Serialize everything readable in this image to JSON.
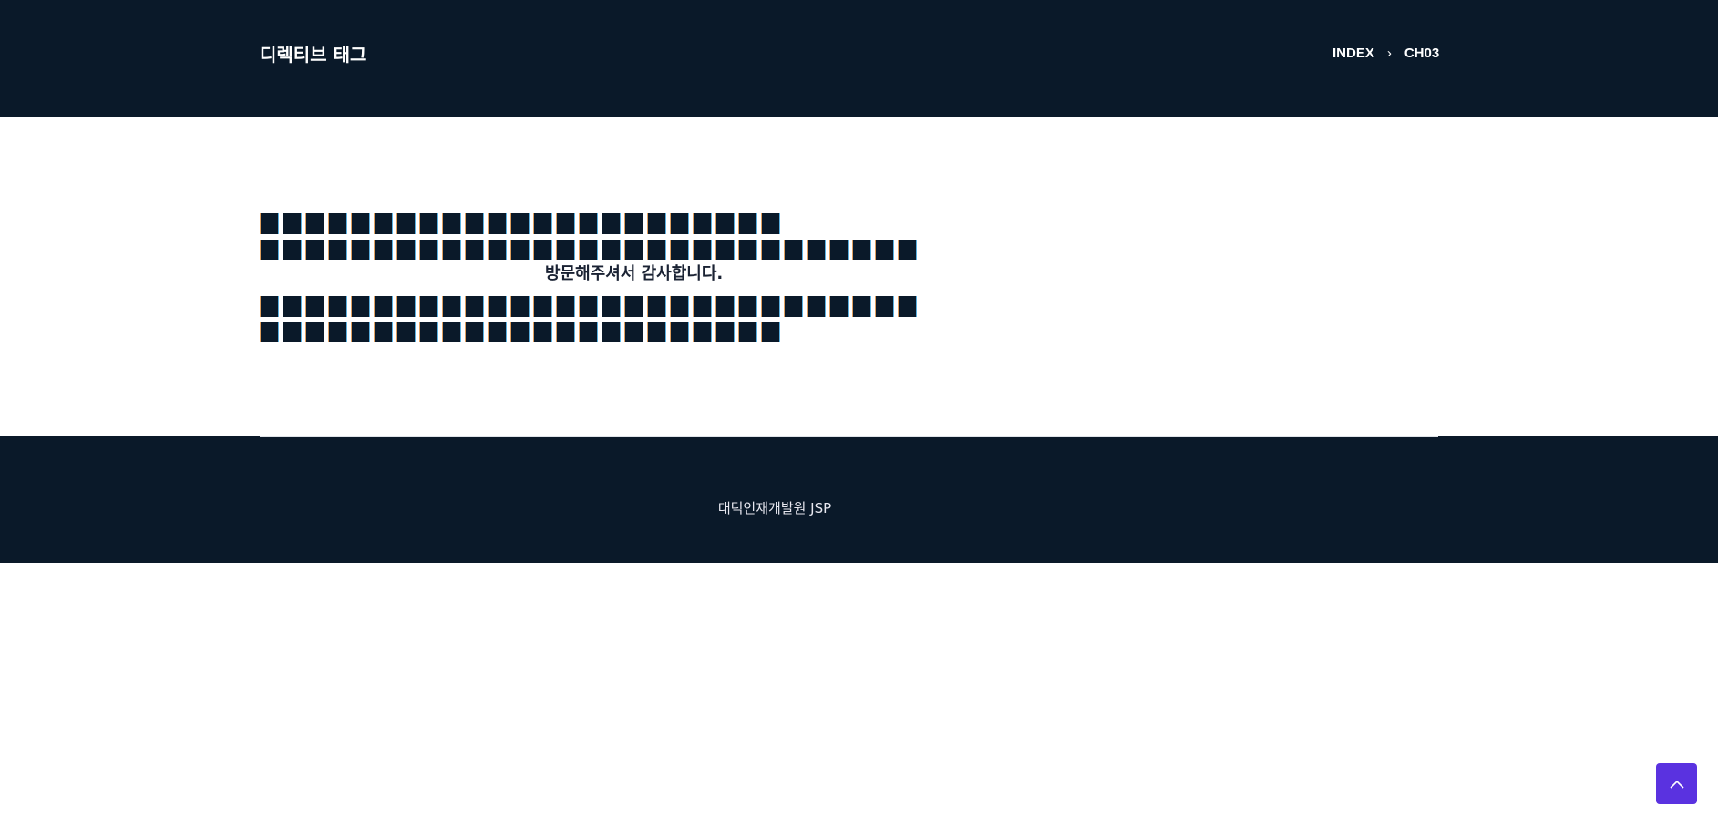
{
  "header": {
    "title": "디렉티브 태그",
    "breadcrumb": [
      {
        "label": "INDEX"
      },
      {
        "label": "CH03"
      }
    ]
  },
  "main": {
    "tofu_lines": [
      "■■■■■■■■■■■■■■■■■■■■■■■",
      "■■■■■■■■■■■■■■■■■■■■■■■■■■■■■",
      "■■■■■■■■■■■■■■■■■■■■■■■■■■■■■",
      "■■■■■■■■■■■■■■■■■■■■■■■"
    ],
    "thanks": "방문해주셔서 감사합니다."
  },
  "footer": {
    "text": "대덕인재개발원 JSP"
  },
  "colors": {
    "dark": "#0a1929",
    "accent": "#5a32e0"
  }
}
